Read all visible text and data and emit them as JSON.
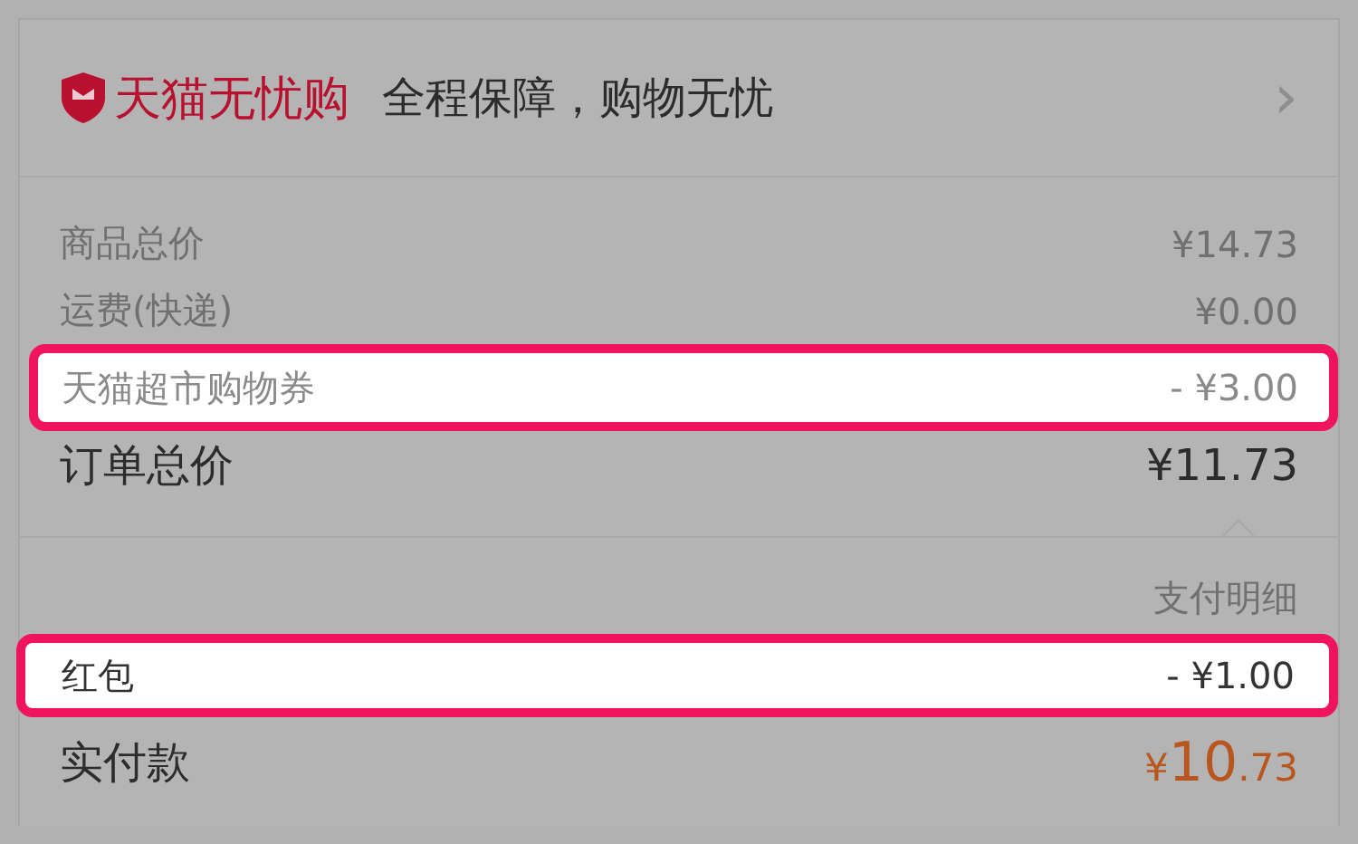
{
  "header": {
    "brand": "天猫无忧购",
    "slogan": "全程保障，购物无忧",
    "chevron": "›"
  },
  "price_rows": [
    {
      "label": "商品总价",
      "amount": "¥14.73",
      "kind": "minor",
      "highlighted": false
    },
    {
      "label": "运费(快递)",
      "amount": "¥0.00",
      "kind": "minor",
      "highlighted": false
    },
    {
      "label": "天猫超市购物券",
      "amount": "- ¥3.00",
      "kind": "minor",
      "highlighted": true
    },
    {
      "label": "订单总价",
      "amount": "¥11.73",
      "kind": "total",
      "highlighted": false
    }
  ],
  "payment_detail": {
    "label": "支付明细"
  },
  "payment_rows": [
    {
      "label": "红包",
      "amount": "- ¥1.00",
      "highlighted": true
    }
  ],
  "paid": {
    "label": "实付款",
    "currency": "¥",
    "integer": "10",
    "decimal": ".73"
  }
}
